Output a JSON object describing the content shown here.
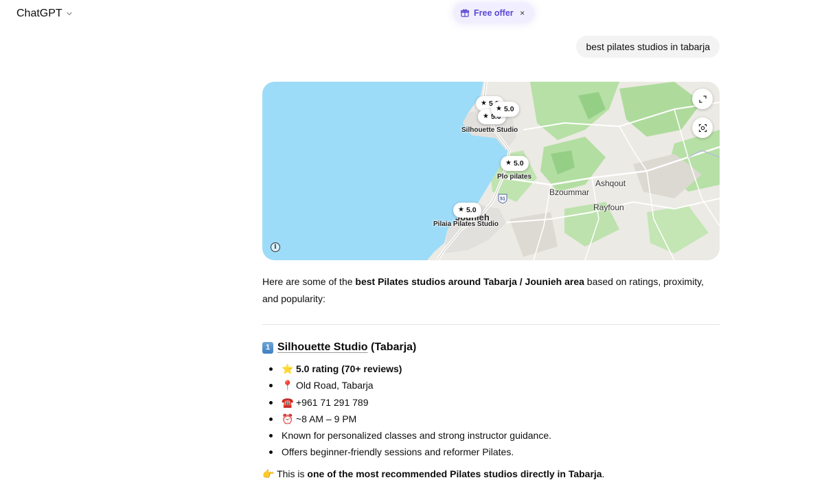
{
  "header": {
    "model_name": "ChatGPT",
    "offer_label": "Free offer",
    "offer_close": "×"
  },
  "user_message": "best pilates studios in tabarja",
  "map": {
    "pins": [
      {
        "rating": "5.0"
      },
      {
        "rating": "5.0"
      },
      {
        "rating": "5.0"
      },
      {
        "rating": "5.0"
      },
      {
        "rating": "5.0"
      }
    ],
    "places": [
      "Silhouette Studio",
      "Plo pilates",
      "Pilaia Pilates Studio"
    ],
    "towns": [
      "Ashqout",
      "Bzoummar",
      "Rayfoun"
    ],
    "city": "Jounieh",
    "road_shield": "51",
    "info_glyph": "i",
    "colors": {
      "sea": "#9ddcf8",
      "land": "#eceae4",
      "green": "#a9d99a",
      "road": "#ffffff"
    }
  },
  "response": {
    "intro_pre": "Here are some of the ",
    "intro_bold": "best Pilates studios around Tabarja / Jounieh area",
    "intro_post": " based on ratings, proximity, and popularity:",
    "section": {
      "number": "1",
      "name": "Silhouette Studio",
      "suffix": " (Tabarja)"
    },
    "facts": [
      {
        "emoji": "⭐",
        "text": "5.0 rating (70+ reviews)",
        "bold": true
      },
      {
        "emoji": "📍",
        "text": "Old Road, Tabarja",
        "bold": false
      },
      {
        "emoji": "☎️",
        "text": "+961 71 291 789",
        "bold": false
      },
      {
        "emoji": "⏰",
        "text": "~8 AM – 9 PM",
        "bold": false
      },
      {
        "emoji": "",
        "text": "Known for personalized classes and strong instructor guidance.",
        "bold": false
      },
      {
        "emoji": "",
        "text": "Offers beginner-friendly sessions and reformer Pilates.",
        "bold": false
      }
    ],
    "closing_emoji": "👉",
    "closing_pre": " This is ",
    "closing_bold": "one of the most recommended Pilates studios directly in Tabarja",
    "closing_post": "."
  }
}
